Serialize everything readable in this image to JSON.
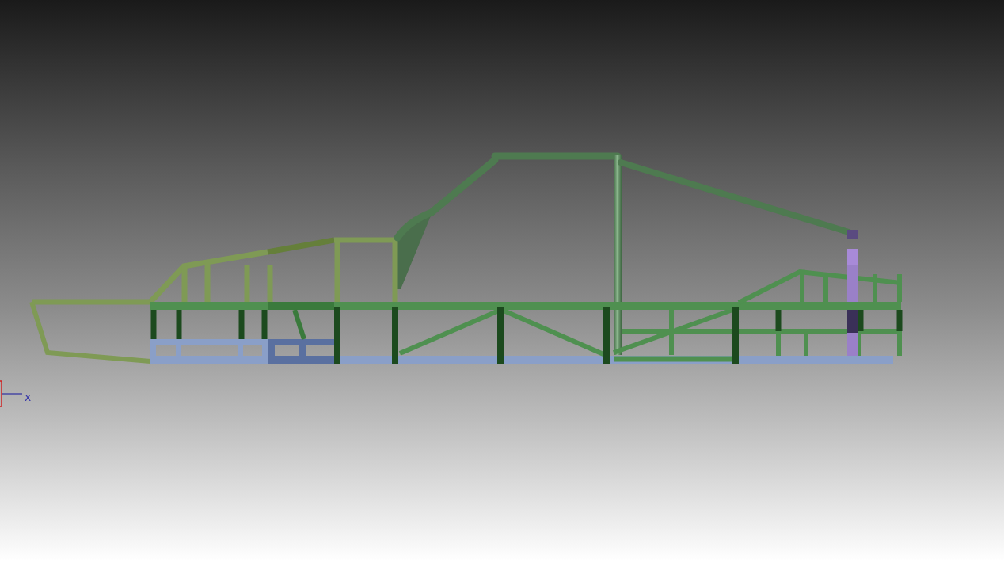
{
  "viewport": {
    "axis_label": "x"
  }
}
